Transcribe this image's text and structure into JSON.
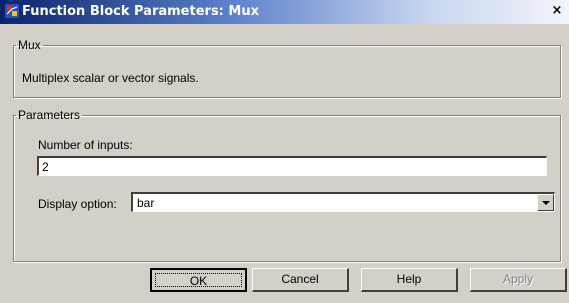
{
  "window": {
    "title": "Function Block Parameters: Mux",
    "close_label": "×"
  },
  "mux_group": {
    "legend": "Mux",
    "description": "Multiplex scalar or vector signals."
  },
  "parameters_group": {
    "legend": "Parameters",
    "number_of_inputs_label": "Number of inputs:",
    "number_of_inputs_value": "2",
    "display_option_label": "Display option:",
    "display_option_value": "bar"
  },
  "buttons": {
    "ok": "OK",
    "cancel": "Cancel",
    "help": "Help",
    "apply": "Apply"
  },
  "colors": {
    "titlebar_start": "#0a246a",
    "dialog_face": "#d4d0c8"
  }
}
